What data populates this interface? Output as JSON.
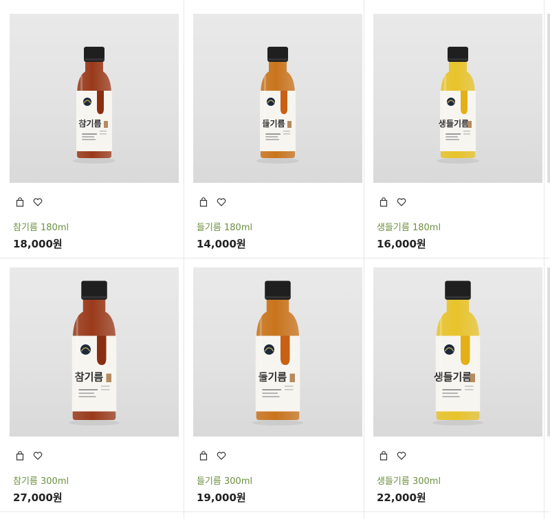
{
  "products": [
    {
      "name": "참기름 180ml",
      "price": "18,000원",
      "oil_color": "#9a3a1a",
      "drop_color": "#8a2e12",
      "label_script": "참기름",
      "size": "small"
    },
    {
      "name": "들기름 180ml",
      "price": "14,000원",
      "oil_color": "#c9741c",
      "drop_color": "#c86016",
      "label_script": "들기름",
      "size": "small"
    },
    {
      "name": "생들기름 180ml",
      "price": "16,000원",
      "oil_color": "#e8c32a",
      "drop_color": "#e3b018",
      "label_script": "생들기름",
      "size": "small"
    },
    {
      "name": "참기름 300ml",
      "price": "27,000원",
      "oil_color": "#9a3a1a",
      "drop_color": "#8a2e12",
      "label_script": "참기름",
      "size": "large"
    },
    {
      "name": "들기름 300ml",
      "price": "19,000원",
      "oil_color": "#c9741c",
      "drop_color": "#c86016",
      "label_script": "들기름",
      "size": "large"
    },
    {
      "name": "생들기름 300ml",
      "price": "22,000원",
      "oil_color": "#e8c32a",
      "drop_color": "#e3b018",
      "label_script": "생들기름",
      "size": "large"
    }
  ],
  "icons": {
    "cart": "shopping-bag-icon",
    "wish": "heart-icon"
  },
  "colors": {
    "product_name": "#6b8f3f",
    "price": "#222222",
    "divider": "#e6e6e6"
  }
}
